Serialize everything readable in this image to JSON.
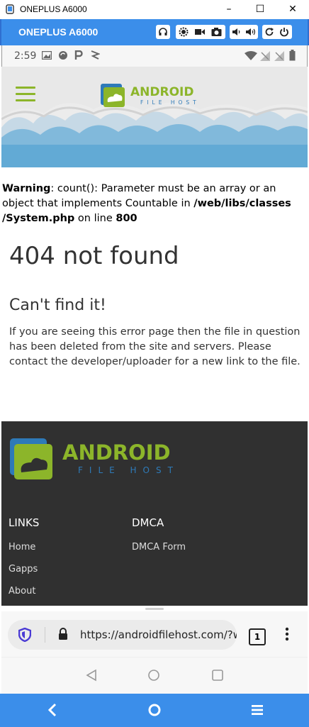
{
  "window": {
    "title": "ONEPLUS A6000",
    "minimize": "–",
    "maximize": "☐",
    "close": "✕"
  },
  "emulator": {
    "device_name": "ONEPLUS A6000"
  },
  "status_bar": {
    "time": "2:59"
  },
  "site": {
    "logo_top": "ANDROID",
    "logo_bottom": "FILE HOST",
    "warning_label": "Warning",
    "warning_text": ": count(): Parameter must be an array or an object that implements Countable in ",
    "warning_path": "/web/libs/classes /System.php",
    "warning_line_text": " on line ",
    "warning_line": "800",
    "heading": "404 not found",
    "subheading": "Can't find it!",
    "paragraph": "If you are seeing this error page then the file in question has been deleted from the site and servers. Please contact the developer/uploader for a new link to the file."
  },
  "footer": {
    "links_heading": "LINKS",
    "dmca_heading": "DMCA",
    "links": [
      "Home",
      "Gapps",
      "About"
    ],
    "dmca_links": [
      "DMCA Form"
    ]
  },
  "browser": {
    "url": "https://androidfilehost.com/?w",
    "tab_count": "1"
  },
  "colors": {
    "brand_green": "#8cb52a",
    "emulator_blue": "#3b8eea",
    "footer_bg": "#303030"
  }
}
